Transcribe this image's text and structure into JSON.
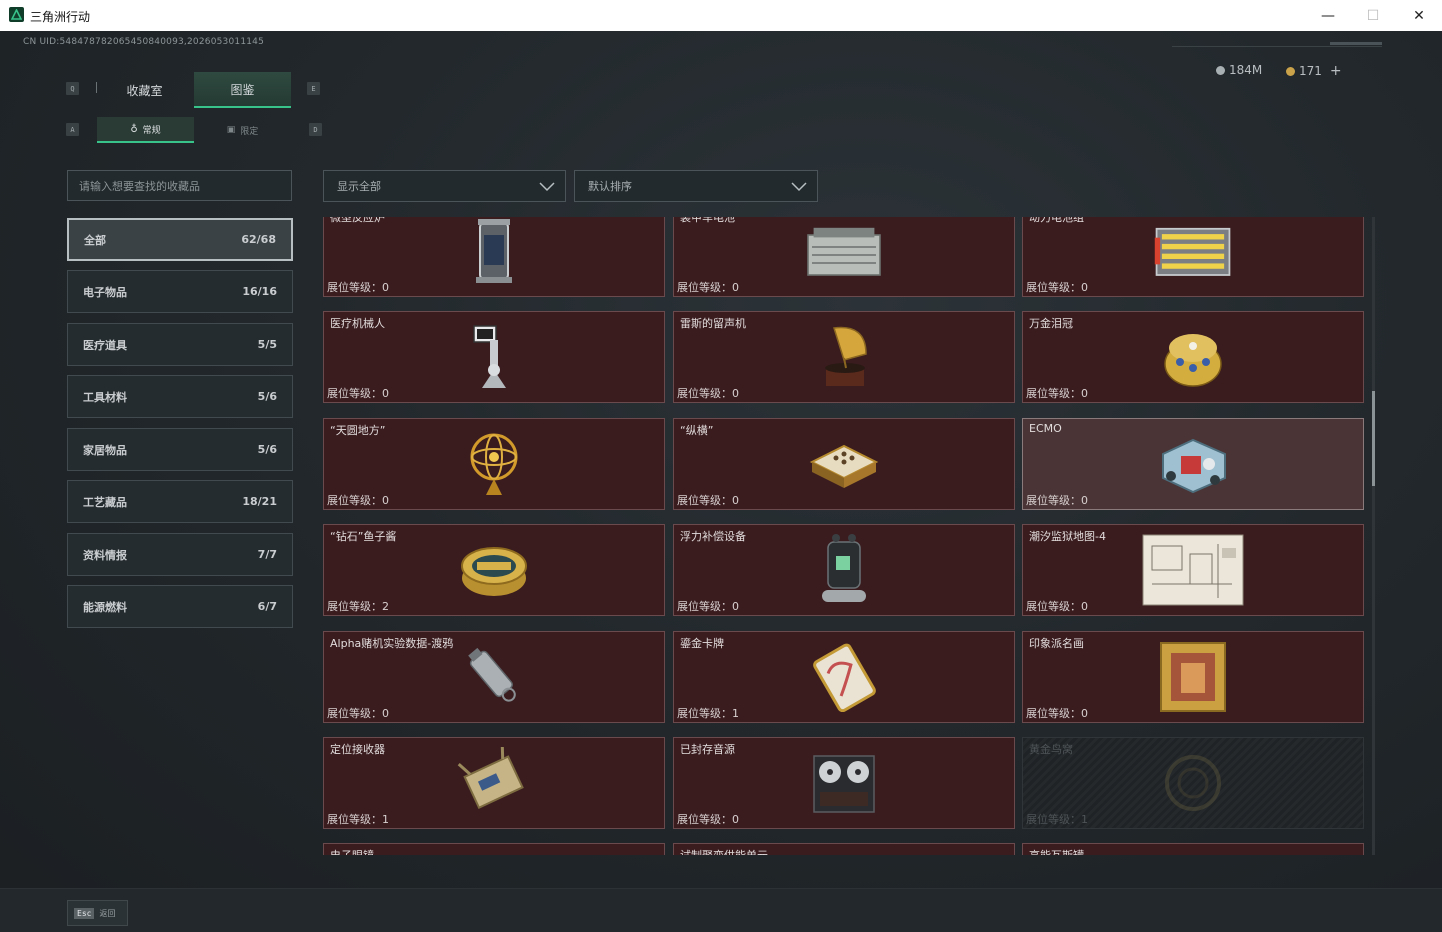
{
  "window": {
    "title": "三角洲行动",
    "minimize": "—",
    "maximize": "☐",
    "close": "✕"
  },
  "uid": "CN UID:548478782065450840093,2026053011145",
  "currency": {
    "silver": "184M",
    "gold": "171",
    "add": "+"
  },
  "hints": {
    "left_tab": "Q",
    "right_tab": "E",
    "left_sub": "A",
    "right_sub": "D"
  },
  "tabs": [
    {
      "label": "收藏室"
    },
    {
      "label": "图鉴"
    }
  ],
  "subtabs": [
    {
      "label": "常规"
    },
    {
      "label": "限定"
    }
  ],
  "search": {
    "placeholder": "请输入想要查找的收藏品"
  },
  "filters": {
    "show": "显示全部",
    "sort": "默认排序"
  },
  "categories": [
    {
      "label": "全部",
      "count": "62/68"
    },
    {
      "label": "电子物品",
      "count": "16/16"
    },
    {
      "label": "医疗道具",
      "count": "5/5"
    },
    {
      "label": "工具材料",
      "count": "5/6"
    },
    {
      "label": "家居物品",
      "count": "5/6"
    },
    {
      "label": "工艺藏品",
      "count": "18/21"
    },
    {
      "label": "资料情报",
      "count": "7/7"
    },
    {
      "label": "能源燃料",
      "count": "6/7"
    }
  ],
  "level_label": "展位等级：",
  "cards": [
    {
      "name": "微型反应炉",
      "level": "0",
      "icon": "reactor-icon"
    },
    {
      "name": "装甲车电池",
      "level": "0",
      "icon": "battery-icon"
    },
    {
      "name": "动力电池组",
      "level": "0",
      "icon": "battery-pack-icon"
    },
    {
      "name": "医疗机械人",
      "level": "0",
      "icon": "robot-arm-icon"
    },
    {
      "name": "雷斯的留声机",
      "level": "0",
      "icon": "gramophone-icon"
    },
    {
      "name": "万金泪冠",
      "level": "0",
      "icon": "crown-egg-icon"
    },
    {
      "name": "“天圆地方”",
      "level": "0",
      "icon": "armillary-icon"
    },
    {
      "name": "“纵横”",
      "level": "0",
      "icon": "chessboard-icon"
    },
    {
      "name": "ECMO",
      "level": "0",
      "icon": "ecmo-icon"
    },
    {
      "name": "“钻石”鱼子酱",
      "level": "2",
      "icon": "caviar-icon"
    },
    {
      "name": "浮力补偿设备",
      "level": "0",
      "icon": "bcd-icon"
    },
    {
      "name": "潮汐监狱地图-4",
      "level": "0",
      "icon": "map-icon"
    },
    {
      "name": "Alpha赌机实验数据-渡鸦",
      "level": "0",
      "icon": "usb-drive-icon"
    },
    {
      "name": "鎏金卡牌",
      "level": "1",
      "icon": "gold-card-icon"
    },
    {
      "name": "印象派名画",
      "level": "0",
      "icon": "painting-icon"
    },
    {
      "name": "定位接收器",
      "level": "1",
      "icon": "receiver-icon"
    },
    {
      "name": "已封存音源",
      "level": "0",
      "icon": "tape-recorder-icon"
    },
    {
      "name": "黄金鸟窝",
      "level": "1",
      "icon": "gold-nest-icon"
    },
    {
      "name": "电子眼镜",
      "level": "",
      "icon": "glasses-icon"
    },
    {
      "name": "试制聚变供能单元",
      "level": "",
      "icon": "fusion-cell-icon"
    },
    {
      "name": "高能瓦斯罐",
      "level": "",
      "icon": "gas-tank-icon"
    }
  ],
  "footer": {
    "esc_key": "Esc",
    "back": "返回"
  },
  "colors": {
    "accent": "#37c38a",
    "card_bg": "#3a1c1f",
    "card_border": "#6a4a4d"
  }
}
